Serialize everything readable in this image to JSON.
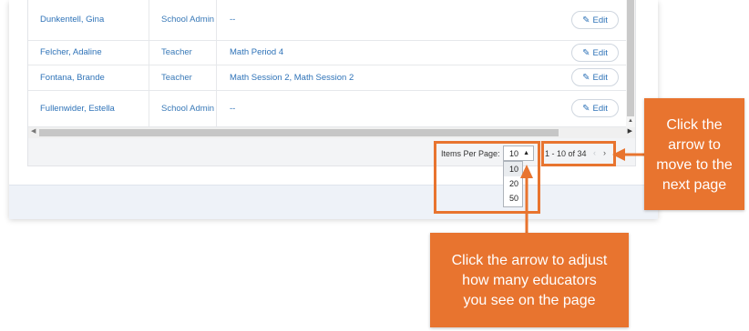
{
  "table": {
    "rows": [
      {
        "name": "Dunkentell, Gina",
        "role": "School Admin",
        "classes": "--",
        "edit": "Edit"
      },
      {
        "name": "Felcher, Adaline",
        "role": "Teacher",
        "classes": "Math Period 4",
        "edit": "Edit"
      },
      {
        "name": "Fontana, Brande",
        "role": "Teacher",
        "classes": "Math Session 2, Math Session 2",
        "edit": "Edit"
      },
      {
        "name": "Fullenwider, Estella",
        "role": "School Admin",
        "classes": "--",
        "edit": "Edit"
      }
    ]
  },
  "pager": {
    "items_per_page_label": "Items Per Page:",
    "selected": "10",
    "options": [
      "10",
      "20",
      "50"
    ],
    "range": "1 - 10 of 34",
    "prev": "‹",
    "next": "›"
  },
  "callouts": {
    "next_page": [
      "Click the",
      "arrow to",
      "move to the",
      "next page"
    ],
    "items_per_page": [
      "Click the arrow to adjust",
      "how many educators",
      "you see on the page"
    ]
  },
  "colors": {
    "accent": "#e8742f",
    "link": "#2f73b8"
  }
}
